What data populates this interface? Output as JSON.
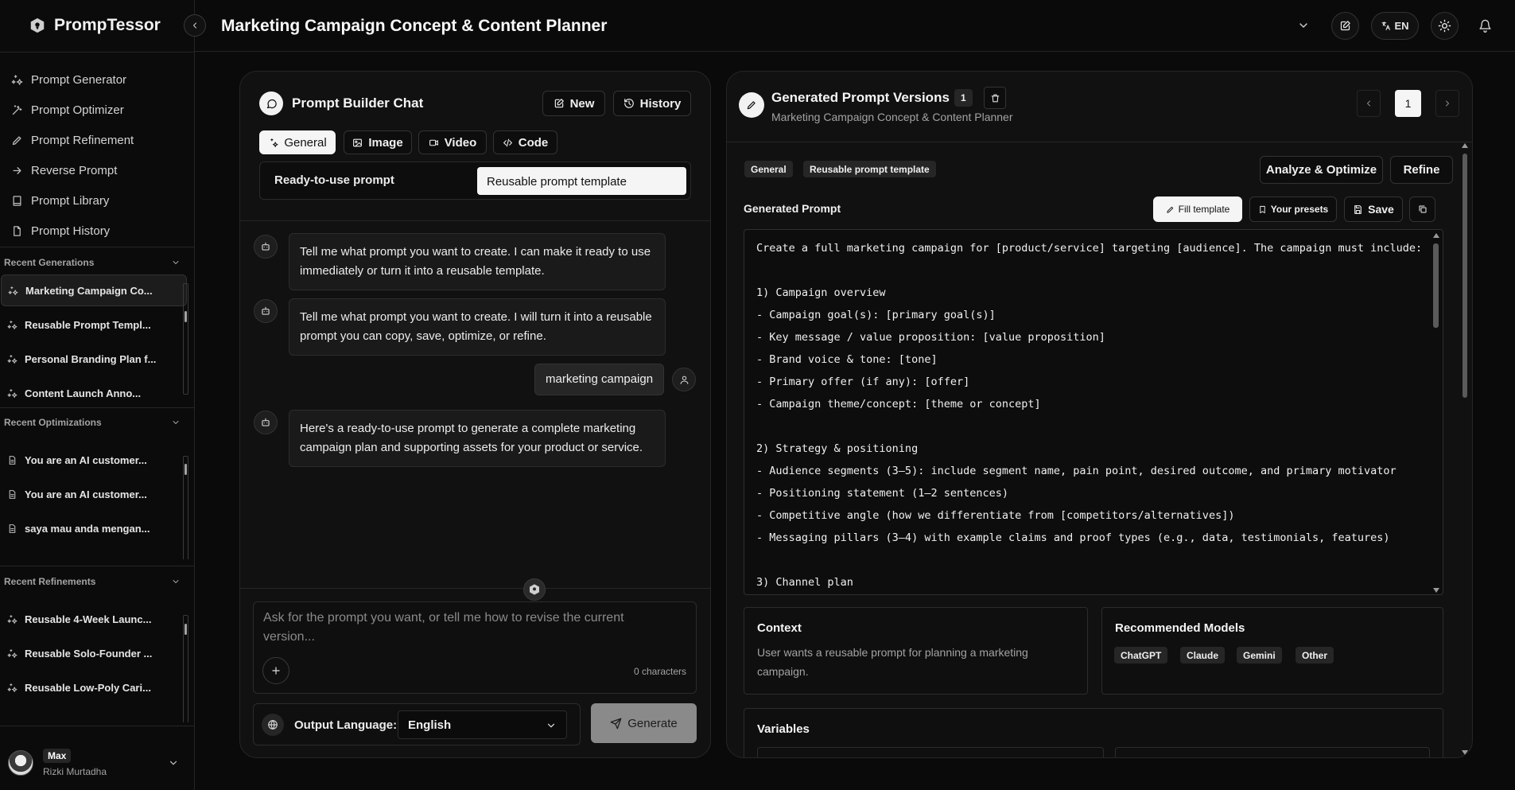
{
  "app": {
    "name": "PrompTessor"
  },
  "nav": [
    {
      "label": "Prompt Generator",
      "icon": "sparkles-icon"
    },
    {
      "label": "Prompt Optimizer",
      "icon": "wand-icon"
    },
    {
      "label": "Prompt Refinement",
      "icon": "pencil-icon"
    },
    {
      "label": "Reverse Prompt",
      "icon": "arrow-right-icon"
    },
    {
      "label": "Prompt Library",
      "icon": "book-icon"
    },
    {
      "label": "Prompt History",
      "icon": "file-icon"
    }
  ],
  "recent_generations": {
    "title": "Recent Generations",
    "items": [
      "Marketing Campaign Co...",
      "Reusable Prompt Templ...",
      "Personal Branding Plan f...",
      "Content Launch Anno..."
    ]
  },
  "recent_optimizations": {
    "title": "Recent Optimizations",
    "items": [
      "You are an AI customer...",
      "You are an AI customer...",
      "saya mau anda mengan..."
    ]
  },
  "recent_refinements": {
    "title": "Recent Refinements",
    "items": [
      "Reusable 4-Week Launc...",
      "Reusable Solo-Founder ...",
      "Reusable Low-Poly Cari..."
    ]
  },
  "user": {
    "badge": "Max",
    "name": "Rizki Murtadha"
  },
  "header": {
    "title": "Marketing Campaign Concept & Content Planner",
    "lang": "EN"
  },
  "chat": {
    "title": "Prompt Builder Chat",
    "new_label": "New",
    "history_label": "History",
    "tabs": [
      "General",
      "Image",
      "Video",
      "Code"
    ],
    "modes": [
      "Ready-to-use prompt",
      "Reusable prompt template"
    ],
    "messages": [
      {
        "role": "bot",
        "text": "Tell me what prompt you want to create. I can make it ready to use immediately or turn it into a reusable template."
      },
      {
        "role": "bot",
        "text": "Tell me what prompt you want to create. I will turn it into a reusable prompt you can copy, save, optimize, or refine."
      },
      {
        "role": "user",
        "text": "marketing campaign"
      },
      {
        "role": "bot",
        "text": "Here's a ready-to-use prompt to generate a complete marketing campaign plan and supporting assets for your product or service."
      }
    ],
    "input_placeholder": "Ask for the prompt you want, or tell me how to revise the current version...",
    "char_count": "0 characters",
    "output_language_label": "Output Language:",
    "output_language_value": "English",
    "generate_label": "Generate"
  },
  "versions": {
    "title": "Generated Prompt Versions",
    "count": "1",
    "subtitle": "Marketing Campaign Concept & Content Planner",
    "page": "1",
    "tags": [
      "General",
      "Reusable prompt template"
    ],
    "analyze_label": "Analyze & Optimize",
    "refine_label": "Refine",
    "generated_prompt_label": "Generated Prompt",
    "fill_template_label": "Fill template",
    "presets_label": "Your presets",
    "save_label": "Save",
    "prompt_lines": [
      "Create a full marketing campaign for [product/service] targeting [audience]. The campaign must include:",
      "",
      "1) Campaign overview",
      "- Campaign goal(s): [primary goal(s)]",
      "- Key message / value proposition: [value proposition]",
      "- Brand voice & tone: [tone]",
      "- Primary offer (if any): [offer]",
      "- Campaign theme/concept: [theme or concept]",
      "",
      "2) Strategy & positioning",
      "- Audience segments (3–5): include segment name, pain point, desired outcome, and primary motivator",
      "- Positioning statement (1–2 sentences)",
      "- Competitive angle (how we differentiate from [competitors/alternatives])",
      "- Messaging pillars (3–4) with example claims and proof types (e.g., data, testimonials, features)",
      "",
      "3) Channel plan"
    ],
    "context_title": "Context",
    "context_text": "User wants a reusable prompt for planning a marketing campaign.",
    "models_title": "Recommended Models",
    "models": [
      "ChatGPT",
      "Claude",
      "Gemini",
      "Other"
    ],
    "variables_title": "Variables"
  }
}
